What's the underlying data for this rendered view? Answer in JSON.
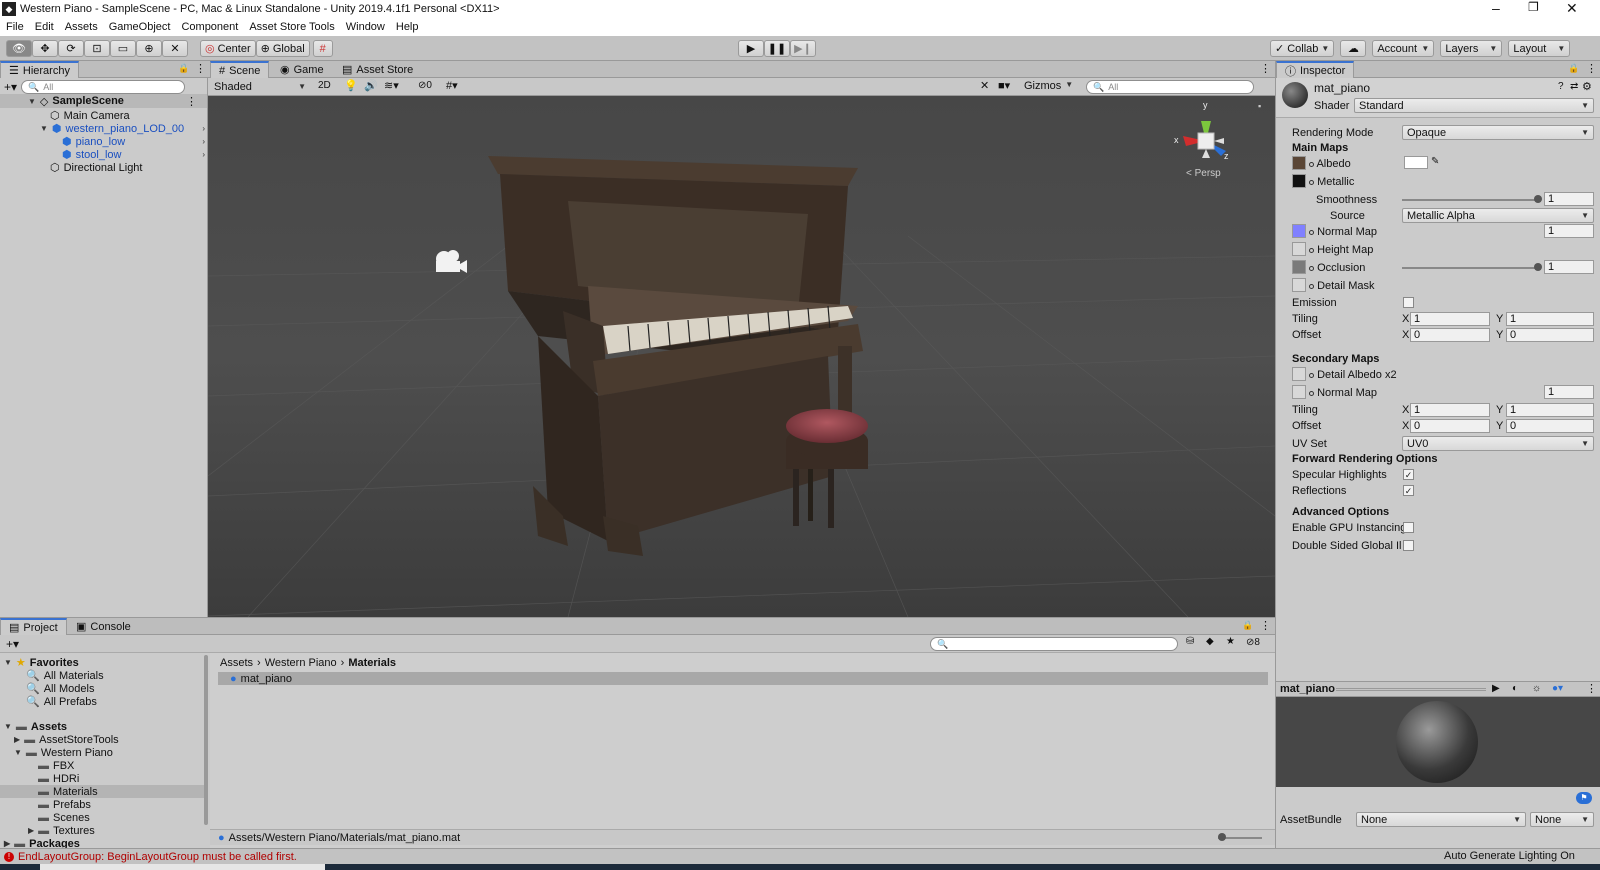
{
  "window": {
    "title": "Western Piano - SampleScene - PC, Mac & Linux Standalone - Unity 2019.4.1f1 Personal <DX11>"
  },
  "menu": [
    "File",
    "Edit",
    "Assets",
    "GameObject",
    "Component",
    "Asset Store Tools",
    "Window",
    "Help"
  ],
  "toolbar": {
    "pivot_label": "Center",
    "space_label": "Global",
    "collab_label": "Collab",
    "account_label": "Account",
    "layers_label": "Layers",
    "layout_label": "Layout"
  },
  "hierarchy": {
    "tab": "Hierarchy",
    "search_placeholder": "All",
    "scene": "SampleScene",
    "items": [
      "Main Camera",
      "western_piano_LOD_00",
      "piano_low",
      "stool_low",
      "Directional Light"
    ]
  },
  "scene_view": {
    "tabs": [
      "Scene",
      "Game",
      "Asset Store"
    ],
    "shading": "Shaded",
    "mode_2d": "2D",
    "hidden_count": "0",
    "gizmos": "Gizmos",
    "search_placeholder": "All",
    "axis_y": "y",
    "axis_x": "x",
    "axis_z": "z",
    "persp": "< Persp"
  },
  "inspector": {
    "tab": "Inspector",
    "material_name": "mat_piano",
    "shader_label": "Shader",
    "shader_value": "Standard",
    "rendering_mode_label": "Rendering Mode",
    "rendering_mode_value": "Opaque",
    "main_maps": "Main Maps",
    "albedo": "Albedo",
    "metallic": "Metallic",
    "smoothness": "Smoothness",
    "smoothness_value": "1",
    "source": "Source",
    "source_value": "Metallic Alpha",
    "normal_map": "Normal Map",
    "normal_map_value": "1",
    "height_map": "Height Map",
    "occlusion": "Occlusion",
    "occlusion_value": "1",
    "detail_mask": "Detail Mask",
    "emission": "Emission",
    "tiling": "Tiling",
    "offset": "Offset",
    "x": "X",
    "y": "Y",
    "tiling_x": "1",
    "tiling_y": "1",
    "offset_x": "0",
    "offset_y": "0",
    "secondary_maps": "Secondary Maps",
    "detail_albedo": "Detail Albedo x2",
    "sec_normal_map": "Normal Map",
    "sec_normal_value": "1",
    "sec_tiling_x": "1",
    "sec_tiling_y": "1",
    "sec_offset_x": "0",
    "sec_offset_y": "0",
    "uv_set": "UV Set",
    "uv_set_value": "UV0",
    "forward_rendering": "Forward Rendering Options",
    "specular_highlights": "Specular Highlights",
    "reflections": "Reflections",
    "advanced_options": "Advanced Options",
    "gpu_instancing": "Enable GPU Instancing",
    "double_sided_gi": "Double Sided Global Illu",
    "preview_name": "mat_piano",
    "asset_bundle_label": "AssetBundle",
    "asset_bundle_value": "None",
    "asset_bundle_variant": "None"
  },
  "project": {
    "tabs": [
      "Project",
      "Console"
    ],
    "favorites": "Favorites",
    "favorite_items": [
      "All Materials",
      "All Models",
      "All Prefabs"
    ],
    "assets": "Assets",
    "tree": [
      "AssetStoreTools",
      "Western Piano",
      "FBX",
      "HDRi",
      "Materials",
      "Prefabs",
      "Scenes",
      "Textures"
    ],
    "packages": "Packages",
    "breadcrumb": [
      "Assets",
      "Western Piano",
      "Materials"
    ],
    "files": [
      "mat_piano"
    ],
    "path": "Assets/Western Piano/Materials/mat_piano.mat",
    "hidden_count": "8"
  },
  "status": {
    "error": "EndLayoutGroup: BeginLayoutGroup must be called first.",
    "lighting": "Auto Generate Lighting On"
  }
}
